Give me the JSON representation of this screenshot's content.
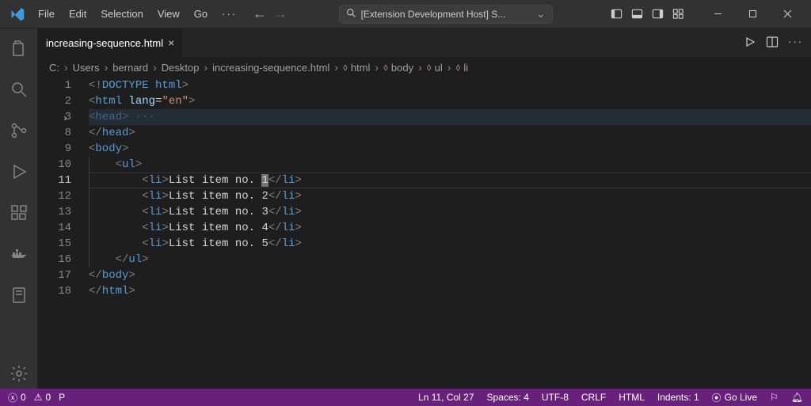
{
  "title_bar": {
    "menu": [
      "File",
      "Edit",
      "Selection",
      "View",
      "Go"
    ],
    "search": "[Extension Development Host] S..."
  },
  "tab": {
    "name": "increasing-sequence.html"
  },
  "breadcrumbs": {
    "path": [
      "C:",
      "Users",
      "bernard",
      "Desktop",
      "increasing-sequence.html"
    ],
    "symbols": [
      "html",
      "body",
      "ul",
      "li"
    ]
  },
  "gutter": {
    "lines": [
      "1",
      "2",
      "3",
      "8",
      "9",
      "10",
      "11",
      "12",
      "13",
      "14",
      "15",
      "16",
      "17",
      "18"
    ],
    "foldable": {
      "3": true
    },
    "current": "11"
  },
  "code": {
    "line1": {
      "pre": "<!",
      "doctype": "DOCTYPE ",
      "dtv": "html",
      "post": ">"
    },
    "line2": {
      "open": "<",
      "tag": "html",
      "sp": " ",
      "attr": "lang",
      "eq": "=",
      "val": "\"en\"",
      "close": ">"
    },
    "line3": {
      "open": "<",
      "tag": "head",
      "close": ">",
      "dots": " ···"
    },
    "line8": {
      "open": "</",
      "tag": "head",
      "close": ">"
    },
    "line9": {
      "open": "<",
      "tag": "body",
      "close": ">"
    },
    "line10": {
      "pad": "    ",
      "open": "<",
      "tag": "ul",
      "close": ">"
    },
    "line11": {
      "pad": "        ",
      "open": "<",
      "tag": "li",
      "close": ">",
      "text_pre": "List item no. ",
      "text_hl": "1",
      "copen": "</",
      "ctag": "li",
      "cclose": ">"
    },
    "line12": {
      "pad": "        ",
      "open": "<",
      "tag": "li",
      "close": ">",
      "text": "List item no. 2",
      "copen": "</",
      "ctag": "li",
      "cclose": ">"
    },
    "line13": {
      "pad": "        ",
      "open": "<",
      "tag": "li",
      "close": ">",
      "text": "List item no. 3",
      "copen": "</",
      "ctag": "li",
      "cclose": ">"
    },
    "line14": {
      "pad": "        ",
      "open": "<",
      "tag": "li",
      "close": ">",
      "text": "List item no. 4",
      "copen": "</",
      "ctag": "li",
      "cclose": ">"
    },
    "line15": {
      "pad": "        ",
      "open": "<",
      "tag": "li",
      "close": ">",
      "text": "List item no. 5",
      "copen": "</",
      "ctag": "li",
      "cclose": ">"
    },
    "line16": {
      "pad": "    ",
      "open": "</",
      "tag": "ul",
      "close": ">"
    },
    "line17": {
      "open": "</",
      "tag": "body",
      "close": ">"
    },
    "line18": {
      "open": "</",
      "tag": "html",
      "close": ">"
    }
  },
  "status": {
    "errors": "0",
    "warnings": "0",
    "port": "P",
    "lncol": "Ln 11, Col 27",
    "spaces": "Spaces: 4",
    "encoding": "UTF-8",
    "eol": "CRLF",
    "lang": "HTML",
    "indents": "Indents: 1",
    "golive": "Go Live"
  }
}
